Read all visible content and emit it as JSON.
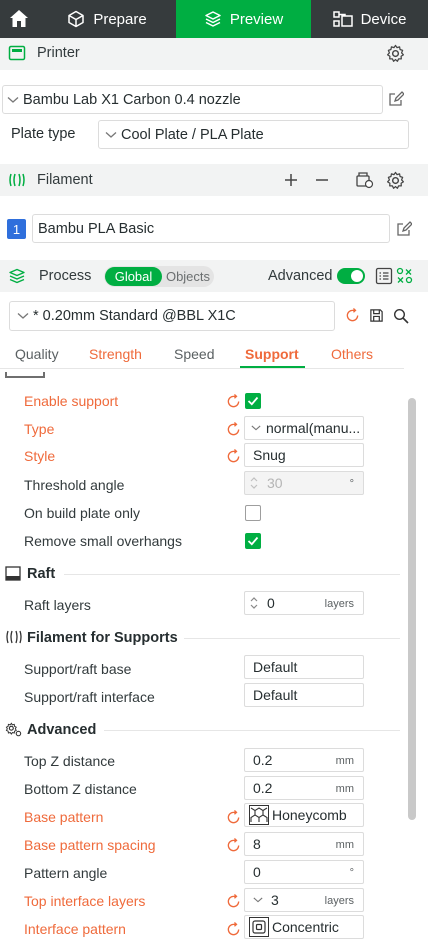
{
  "topbar": {
    "home_icon": "home-icon",
    "tabs": [
      {
        "label": "Prepare",
        "icon": "cube-icon"
      },
      {
        "label": "Preview",
        "icon": "layers-icon",
        "active": true
      },
      {
        "label": "Device",
        "icon": "device-icon"
      }
    ],
    "accent": "#00ae42"
  },
  "printer": {
    "title": "Printer",
    "selected": "Bambu Lab X1 Carbon 0.4 nozzle",
    "plate_type_label": "Plate type",
    "plate_type": "Cool Plate / PLA Plate"
  },
  "filament": {
    "title": "Filament",
    "slots": [
      {
        "index": "1",
        "name": "Bambu PLA Basic",
        "color": "#2f6fdc"
      }
    ]
  },
  "process": {
    "title": "Process",
    "toggle_global": "Global",
    "toggle_objects": "Objects",
    "advanced_label": "Advanced",
    "advanced_on": true,
    "preset": "* 0.20mm Standard @BBL X1C",
    "tabs": [
      "Quality",
      "Strength",
      "Speed",
      "Support",
      "Others"
    ],
    "active_tab": "Support"
  },
  "support": {
    "enable_support": {
      "label": "Enable support",
      "checked": true
    },
    "type": {
      "label": "Type",
      "value": "normal(manu..."
    },
    "style": {
      "label": "Style",
      "value": "Snug"
    },
    "threshold_angle": {
      "label": "Threshold angle",
      "value": "30",
      "unit": "°"
    },
    "on_build_plate_only": {
      "label": "On build plate only",
      "checked": false
    },
    "remove_small_overhangs": {
      "label": "Remove small overhangs",
      "checked": true
    }
  },
  "raft": {
    "title": "Raft",
    "raft_layers": {
      "label": "Raft layers",
      "value": "0",
      "unit": "layers"
    }
  },
  "filament_for_supports": {
    "title": "Filament for Supports",
    "base": {
      "label": "Support/raft base",
      "value": "Default"
    },
    "interface": {
      "label": "Support/raft interface",
      "value": "Default"
    }
  },
  "advanced": {
    "title": "Advanced",
    "top_z": {
      "label": "Top Z distance",
      "value": "0.2",
      "unit": "mm"
    },
    "bottom_z": {
      "label": "Bottom Z distance",
      "value": "0.2",
      "unit": "mm"
    },
    "base_pattern": {
      "label": "Base pattern",
      "value": "Honeycomb"
    },
    "base_pattern_spacing": {
      "label": "Base pattern spacing",
      "value": "8",
      "unit": "mm"
    },
    "pattern_angle": {
      "label": "Pattern angle",
      "value": "0",
      "unit": "°"
    },
    "top_interface_layers": {
      "label": "Top interface layers",
      "value": "3",
      "unit": "layers"
    },
    "interface_pattern": {
      "label": "Interface pattern",
      "value": "Concentric"
    }
  },
  "colors": {
    "modified": "#ef6a3b",
    "green": "#00ae42"
  }
}
